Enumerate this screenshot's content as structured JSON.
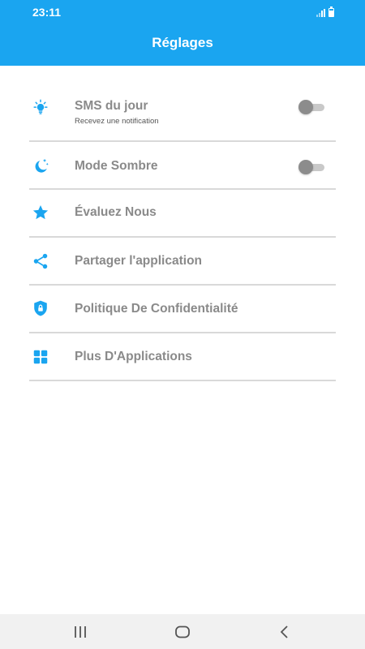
{
  "status_bar": {
    "time": "23:11"
  },
  "header": {
    "title": "Réglages"
  },
  "settings": {
    "items": [
      {
        "label": "SMS du jour",
        "sublabel": "Recevez une notification",
        "icon": "lightbulb-icon",
        "toggle": "off"
      },
      {
        "label": "Mode Sombre",
        "icon": "moon-stars-icon",
        "toggle": "off"
      },
      {
        "label": "Évaluez Nous",
        "icon": "star-icon"
      },
      {
        "label": "Partager l'application",
        "icon": "share-icon"
      },
      {
        "label": "Politique De Confidentialité",
        "icon": "shield-lock-icon"
      },
      {
        "label": "Plus D'Applications",
        "icon": "apps-grid-icon"
      }
    ]
  },
  "colors": {
    "accent": "#1aa5f0",
    "label": "#8a8a8a",
    "divider": "#d9d9d9"
  },
  "nav_bar": {
    "buttons": [
      "recent-apps",
      "home",
      "back"
    ]
  }
}
